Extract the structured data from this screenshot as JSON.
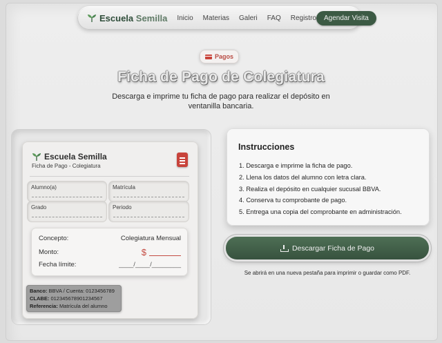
{
  "nav": {
    "brand_first": "Escuela",
    "brand_second": "Semilla",
    "links": [
      "Inicio",
      "Materias",
      "Galeri",
      "FAQ",
      "Registro"
    ],
    "cta": "Agendar Visita"
  },
  "hero": {
    "badge": "Pagos",
    "title": "Ficha de Pago de Colegiatura",
    "subtitle": "Descarga e imprime tu ficha de pago para realizar el depósito en ventanilla bancaria."
  },
  "slip": {
    "brand": "Escuela Semilla",
    "subtitle": "Ficha de Pago - Colegiatura",
    "fields": {
      "alumno": "Alumno(a)",
      "matricula": "Matrícula",
      "grado": "Grado",
      "periodo": "Periodo"
    },
    "concept_label": "Concepto:",
    "concept_value": "Colegiatura Mensual",
    "amount_label": "Monto:",
    "currency": "$",
    "due_label": "Fecha límite:",
    "due_value": "____/____/________",
    "bank": {
      "banco_label": "Banco:",
      "banco_value": "BBVA / Cuenta: 0123456789",
      "clabe_label": "CLABE:",
      "clabe_value": "012345678901234567",
      "ref_label": "Referencia:",
      "ref_value": "Matrícula del alumno"
    }
  },
  "instructions": {
    "title": "Instrucciones",
    "steps": [
      "1. Descarga e imprime la ficha de pago.",
      "2. Llena los datos del alumno con letra clara.",
      "3. Realiza el depósito en cualquier sucusal BBVA.",
      "4. Conserva tu comprobante de pago.",
      "5. Entrega una copia del comprobante en administración."
    ]
  },
  "download": {
    "label": "Descargar Ficha de Pago",
    "note": "Se abrirá en una nueva pestaña para imprimir o guardar como PDF."
  },
  "colors": {
    "accent_green": "#3c5a44",
    "accent_red": "#c8433b"
  }
}
